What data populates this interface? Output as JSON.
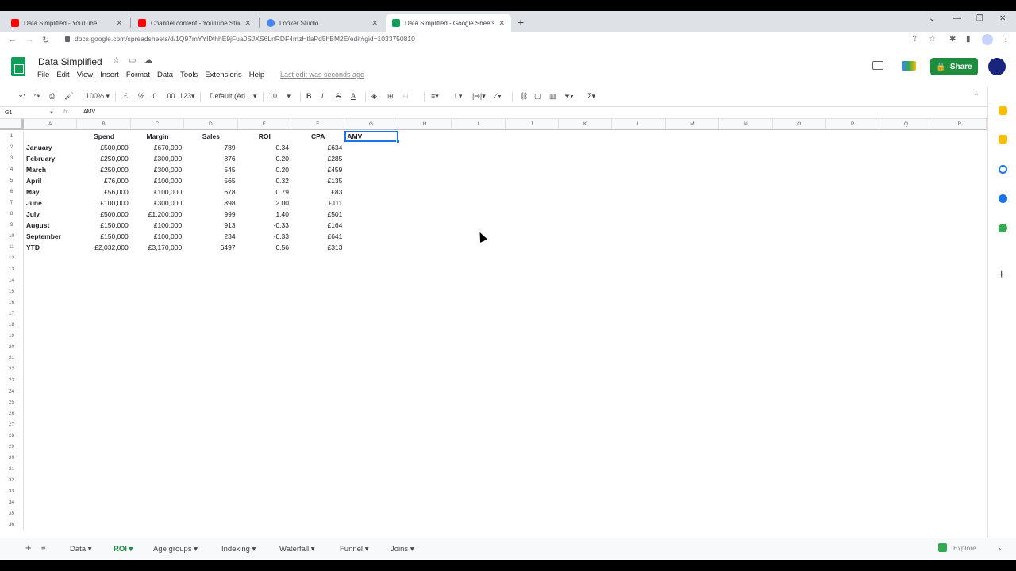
{
  "browser": {
    "tabs": [
      {
        "title": "Data Simplified - YouTube",
        "color": "#ff0000"
      },
      {
        "title": "Channel content - YouTube Studio",
        "color": "#ff0000"
      },
      {
        "title": "Looker Studio",
        "color": "#4285f4"
      },
      {
        "title": "Data Simplified - Google Sheets",
        "color": "#0f9d58"
      }
    ],
    "active_tab": 3,
    "url": "docs.google.com/spreadsheets/d/1Q97mYYlIXhhE9jFua0SJXS6LnRDF4mzHtlaPd5hBM2E/edit#gid=1033750810"
  },
  "doc": {
    "title": "Data Simplified",
    "menu": [
      "File",
      "Edit",
      "View",
      "Insert",
      "Format",
      "Data",
      "Tools",
      "Extensions",
      "Help"
    ],
    "last_edit": "Last edit was seconds ago",
    "share_label": "Share"
  },
  "toolbar": {
    "zoom": "100%",
    "currency": "£",
    "percent": "%",
    "dec_less": ".0",
    "dec_more": ".00",
    "format_more": "123",
    "font": "Default (Ari...",
    "font_size": "10"
  },
  "formula_bar": {
    "cell_ref": "G1",
    "value": "AMV"
  },
  "grid": {
    "columns": [
      "A",
      "B",
      "C",
      "D",
      "E",
      "F",
      "G",
      "H",
      "I",
      "J",
      "K",
      "L",
      "M",
      "N",
      "O",
      "P",
      "Q",
      "R"
    ],
    "row_count": 36,
    "header_row": [
      "",
      "Spend",
      "Margin",
      "Sales",
      "ROI",
      "CPA",
      "AMV"
    ],
    "rows": [
      [
        "January",
        "£500,000",
        "£670,000",
        "789",
        "0.34",
        "£634"
      ],
      [
        "February",
        "£250,000",
        "£300,000",
        "876",
        "0.20",
        "£285"
      ],
      [
        "March",
        "£250,000",
        "£300,000",
        "545",
        "0.20",
        "£459"
      ],
      [
        "April",
        "£76,000",
        "£100,000",
        "565",
        "0.32",
        "£135"
      ],
      [
        "May",
        "£56,000",
        "£100,000",
        "678",
        "0.79",
        "£83"
      ],
      [
        "June",
        "£100,000",
        "£300,000",
        "898",
        "2.00",
        "£111"
      ],
      [
        "July",
        "£500,000",
        "£1,200,000",
        "999",
        "1.40",
        "£501"
      ],
      [
        "August",
        "£150,000",
        "£100,000",
        "913",
        "-0.33",
        "£164"
      ],
      [
        "September",
        "£150,000",
        "£100,000",
        "234",
        "-0.33",
        "£641"
      ],
      [
        "YTD",
        "£2,032,000",
        "£3,170,000",
        "6497",
        "0.56",
        "£313"
      ]
    ],
    "selected_cell": "G1"
  },
  "sheet_tabs": [
    "Data",
    "ROI",
    "Age groups",
    "Indexing",
    "Waterfall",
    "Funnel",
    "Joins"
  ],
  "active_sheet": "ROI",
  "explore_label": "Explore",
  "colors": {
    "accent_green": "#1e8e3e",
    "selection_blue": "#1a73e8"
  }
}
